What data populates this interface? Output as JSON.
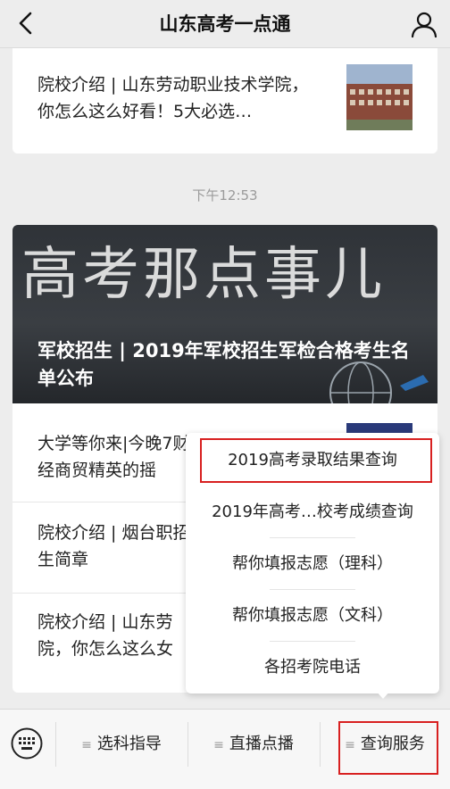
{
  "header": {
    "title": "山东高考一点通",
    "back_icon": "back-chevron-icon",
    "profile_icon": "person-icon"
  },
  "articles_top": {
    "text": "院校介绍 | 山东劳动职业技术学院，你怎么这么好看！5大必选…"
  },
  "timestamp": "下午12:53",
  "feature": {
    "banner_text": "高考那点事儿",
    "title": "军校招生 | 2019年军校招生军检合格考生名单公布"
  },
  "list": [
    {
      "text": "大学等你来|今晚7财经商贸精英的摇"
    },
    {
      "text": "院校介绍 | 烟台职招生简章"
    },
    {
      "text": "院校介绍 | 山东劳院，你怎么这么女"
    }
  ],
  "menu": {
    "items": [
      "2019高考录取结果查询",
      "2019年高考…校考成绩查询",
      "帮你填报志愿（理科）",
      "帮你填报志愿（文科）",
      "各招考院电话"
    ]
  },
  "bottom": {
    "keyboard_icon": "keyboard-icon",
    "tabs": [
      "选科指导",
      "直播点播",
      "查询服务"
    ],
    "highlight_color": "#d82020"
  }
}
